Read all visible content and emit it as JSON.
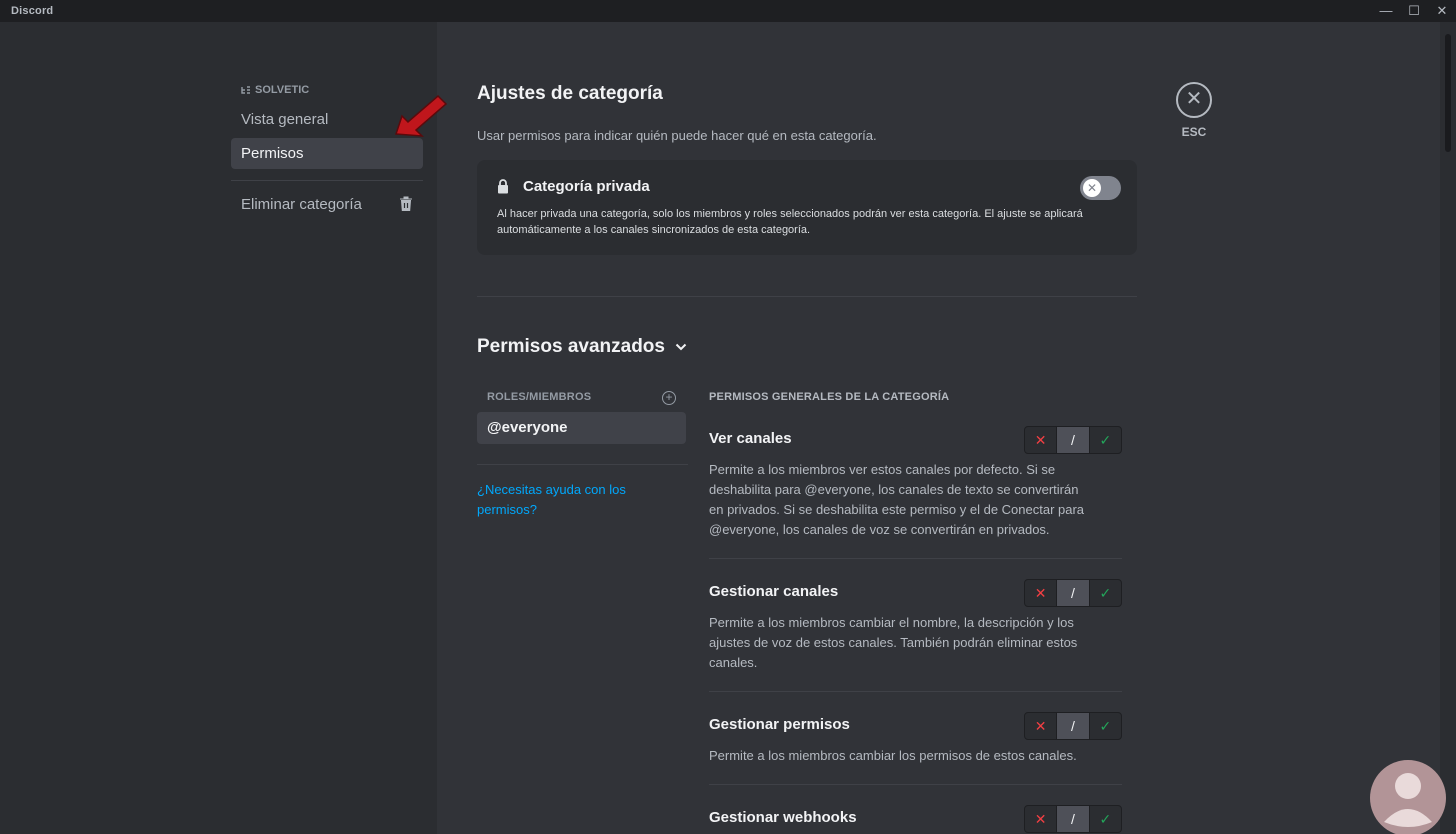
{
  "window": {
    "title": "Discord",
    "minimize": "—",
    "maximize": "☐",
    "close": "✕"
  },
  "sidebar": {
    "header": "SOLVETIC",
    "items": [
      {
        "label": "Vista general",
        "active": false
      },
      {
        "label": "Permisos",
        "active": true
      },
      {
        "label": "Eliminar categoría",
        "icon": "trash-icon"
      }
    ]
  },
  "main": {
    "title": "Ajustes de categoría",
    "subtitle": "Usar permisos para indicar quién puede hacer qué en esta categoría.",
    "private": {
      "title": "Categoría privada",
      "description": "Al hacer privada una categoría, solo los miembros y roles seleccionados podrán ver esta categoría. El ajuste se aplicará automáticamente a los canales sincronizados de esta categoría.",
      "enabled": false
    },
    "advanced_title": "Permisos avanzados",
    "roles_header": "ROLES/MIEMBROS",
    "roles": [
      "@everyone"
    ],
    "help_link": "¿Necesitas ayuda con los permisos?",
    "permissions_header": "PERMISOS GENERALES DE LA CATEGORÍA",
    "permissions": [
      {
        "title": "Ver canales",
        "description": "Permite a los miembros ver estos canales por defecto. Si se deshabilita para @everyone, los canales de texto se convertirán en privados. Si se deshabilita este permiso y el de Conectar para @everyone, los canales de voz se convertirán en privados.",
        "state": "neutral"
      },
      {
        "title": "Gestionar canales",
        "description": "Permite a los miembros cambiar el nombre, la descripción y los ajustes de voz de estos canales. También podrán eliminar estos canales.",
        "state": "neutral"
      },
      {
        "title": "Gestionar permisos",
        "description": "Permite a los miembros cambiar los permisos de estos canales.",
        "state": "neutral"
      },
      {
        "title": "Gestionar webhooks",
        "description": "",
        "state": "neutral"
      }
    ],
    "tri_labels": {
      "deny": "✕",
      "neutral": "/",
      "allow": "✓"
    },
    "close": {
      "symbol": "✕",
      "label": "ESC"
    }
  },
  "colors": {
    "accent_link": "#00a8fc",
    "deny": "#f23f43",
    "allow": "#23a55a",
    "arrow": "#c0161c"
  }
}
